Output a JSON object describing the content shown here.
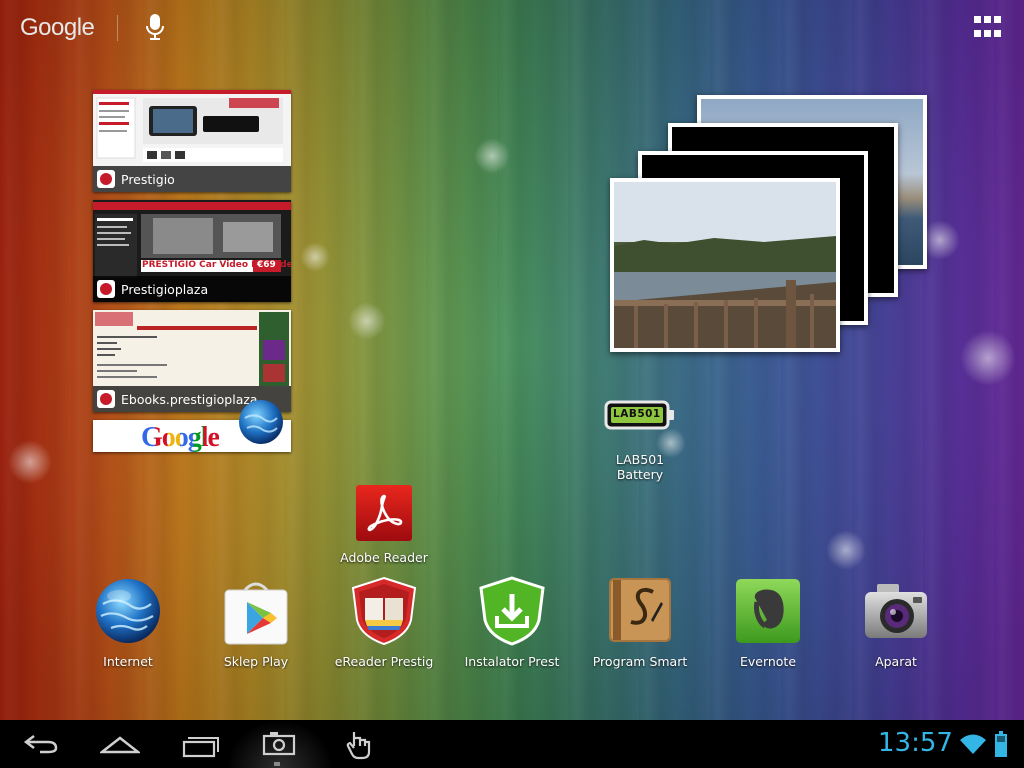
{
  "search": {
    "logo_text": "Google",
    "icon": "mic-icon"
  },
  "top_right": {
    "icon": "apps-grid-icon"
  },
  "bookmarks": [
    {
      "label": "Prestigio"
    },
    {
      "label": "Prestigioplaza",
      "banner": "PRESTIGIO Car Video Recorder",
      "price": "€69"
    },
    {
      "label": "Ebooks.prestigioplaza"
    },
    {
      "label": "Google"
    }
  ],
  "battery_widget": {
    "logo": "LAB501",
    "label": "LAB501 Battery"
  },
  "apps": [
    {
      "label": "Adobe Reader",
      "icon": "adobe-reader-icon"
    },
    {
      "label": "Internet",
      "icon": "globe-icon"
    },
    {
      "label": "Sklep Play",
      "icon": "play-store-icon"
    },
    {
      "label": "eReader Prestig",
      "icon": "ereader-icon"
    },
    {
      "label": "Instalator Prest",
      "icon": "installer-icon"
    },
    {
      "label": "Program Smart",
      "icon": "smart-program-icon"
    },
    {
      "label": "Evernote",
      "icon": "evernote-icon"
    },
    {
      "label": "Aparat",
      "icon": "camera-icon"
    }
  ],
  "navbar": {
    "back_icon": "back-icon",
    "home_icon": "home-icon",
    "recents_icon": "recent-apps-icon",
    "screenshot_icon": "screenshot-icon",
    "touch_icon": "touch-icon"
  },
  "status": {
    "time": "13:57",
    "wifi_icon": "wifi-icon",
    "battery_icon": "battery-icon"
  },
  "colors": {
    "clock": "#33b5e5",
    "navbar": "#000000"
  }
}
